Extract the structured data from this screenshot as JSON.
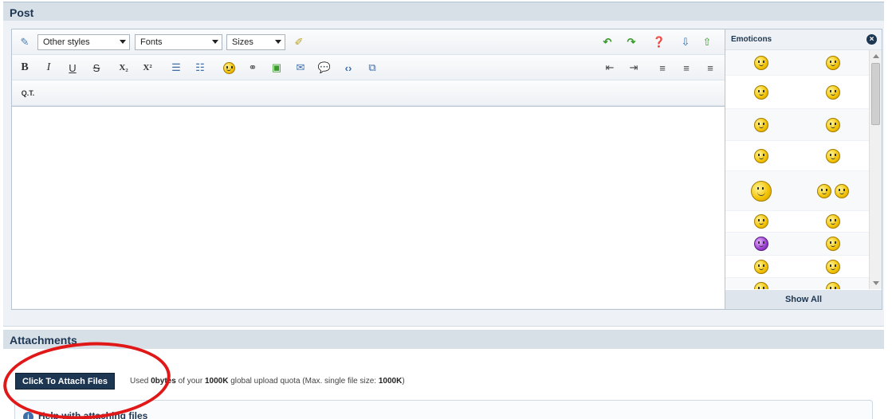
{
  "post": {
    "title": "Post"
  },
  "toolbar": {
    "style_select": "Other styles",
    "font_select": "Fonts",
    "size_select": "Sizes",
    "bold": "B",
    "italic": "I",
    "underline": "U",
    "strike": "S",
    "subscript": "X₂",
    "superscript": "X²",
    "quote_tag": "Q.T."
  },
  "emoticons": {
    "title": "Emoticons",
    "show_all": "Show All"
  },
  "attachments": {
    "title": "Attachments",
    "attach_button": "Click To Attach Files",
    "quota_prefix": "Used ",
    "quota_used": "0bytes",
    "quota_mid": " of your ",
    "quota_total": "1000K",
    "quota_mid2": " global upload quota (Max. single file size: ",
    "quota_max": "1000K",
    "quota_suffix": ")",
    "help_text": "Help with attaching files"
  },
  "colors": {
    "header_bg": "#d7dfe7",
    "accent": "#1d3652",
    "annotation": "#e01818"
  }
}
